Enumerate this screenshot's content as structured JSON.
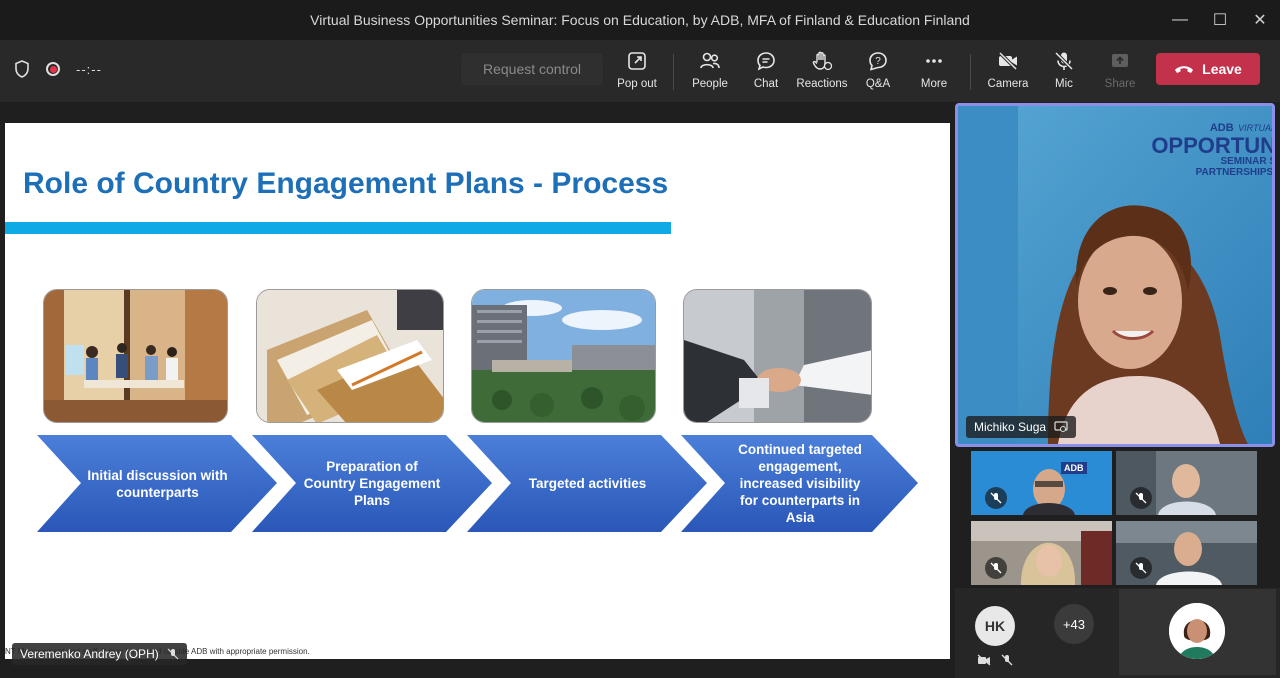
{
  "window": {
    "title": "Virtual Business Opportunities Seminar: Focus on Education, by ADB, MFA of Finland & Education Finland",
    "minimize_icon": "minimize-icon",
    "maximize_icon": "maximize-icon",
    "close_icon": "close-icon"
  },
  "toolbar": {
    "timer": "--:--",
    "request_control": "Request control",
    "buttons": {
      "popout": "Pop out",
      "people": "People",
      "chat": "Chat",
      "reactions": "Reactions",
      "qa": "Q&A",
      "more": "More",
      "camera": "Camera",
      "mic": "Mic",
      "share": "Share"
    },
    "leave": "Leave",
    "leave_color": "#c4314b"
  },
  "slide": {
    "title": "Role of Country Engagement Plans - Process",
    "title_color": "#1d6fb7",
    "bar_color": "#0fa9e6",
    "steps": [
      "Initial discussion with counterparts",
      "Preparation of Country Engagement Plans",
      "Targeted activities",
      "Continued targeted engagement, increased visibility for counterparts in Asia"
    ],
    "footnote": "NT              Management and staff. It may be shared outside ADB with appropriate permission.",
    "presenter_tooltip": "Veremenko Andrey (OPH)"
  },
  "speaker": {
    "name": "Michiko Suga",
    "banner_brand": "ADB",
    "banner_virtual": "VIRTUAL",
    "banner_main": "OPPORTUN",
    "banner_seminar": "SEMINAR S",
    "banner_partnerships": "PARTNERSHIPS."
  },
  "participants": {
    "tile1_badge": "ADB",
    "hk_initials": "HK",
    "overflow_count": "+43"
  }
}
